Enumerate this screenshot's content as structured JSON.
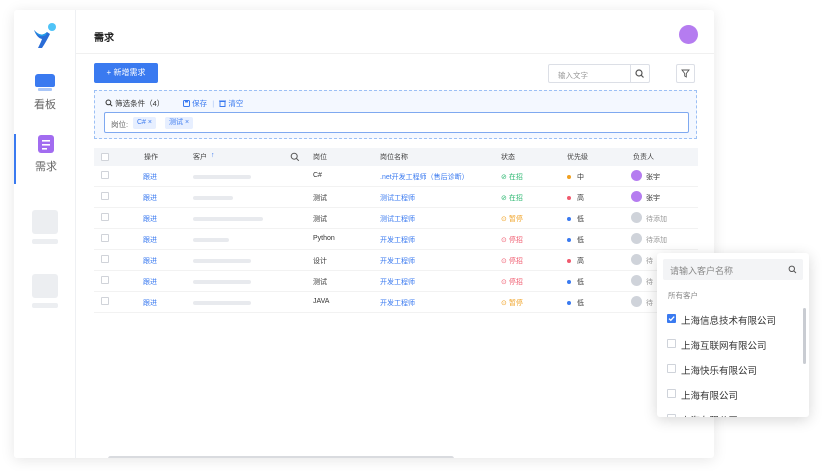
{
  "sidebar": {
    "nav": [
      {
        "label": "看板",
        "icon": "monitor-icon"
      },
      {
        "label": "需求",
        "icon": "document-icon"
      }
    ]
  },
  "header": {
    "title": "需求"
  },
  "toolbar": {
    "new_button": "+ 新增需求",
    "search_placeholder": "输入文字"
  },
  "filter": {
    "title": "筛选条件（4）",
    "save": "保存",
    "divider": "|",
    "clear": "清空",
    "field_label": "岗位:",
    "tags": [
      "C# ×",
      "测试 ×"
    ]
  },
  "table": {
    "headers": [
      "操作",
      "客户",
      "岗位",
      "岗位名称",
      "状态",
      "优先级",
      "负责人"
    ],
    "sort_marker": "↑",
    "rows": [
      {
        "action": "跟进",
        "job": "C#",
        "job_name": ".net开发工程师（售后诊断）",
        "status": "在招",
        "priority": "中",
        "owner": "张宇"
      },
      {
        "action": "跟进",
        "job": "测试",
        "job_name": "测试工程师",
        "status": "在招",
        "priority": "高",
        "owner": "张宇"
      },
      {
        "action": "跟进",
        "job": "测试",
        "job_name": "测试工程师",
        "status": "暂停",
        "priority": "低",
        "owner": "待添加"
      },
      {
        "action": "跟进",
        "job": "Python",
        "job_name": "开发工程师",
        "status": "停招",
        "priority": "低",
        "owner": "待添加"
      },
      {
        "action": "跟进",
        "job": "设计",
        "job_name": "开发工程师",
        "status": "停招",
        "priority": "高",
        "owner": "待"
      },
      {
        "action": "跟进",
        "job": "测试",
        "job_name": "开发工程师",
        "status": "停招",
        "priority": "低",
        "owner": "待"
      },
      {
        "action": "跟进",
        "job": "JAVA",
        "job_name": "开发工程师",
        "status": "暂停",
        "priority": "低",
        "owner": "待"
      }
    ]
  },
  "dropdown": {
    "search_placeholder": "请输入客户名称",
    "group_label": "所有客户",
    "options": [
      {
        "label": "上海信息技术有限公司",
        "checked": true
      },
      {
        "label": "上海互联网有限公司",
        "checked": false
      },
      {
        "label": "上海快乐有限公司",
        "checked": false
      },
      {
        "label": "上海有限公司",
        "checked": false
      },
      {
        "label": "上海有限公司",
        "checked": false
      }
    ]
  },
  "colors": {
    "accent": "#3a7af0",
    "status_active": "#2eb872",
    "status_paused": "#f0a020",
    "status_stopped": "#f05a6e",
    "priority_high": "#f05a6e",
    "priority_mid": "#f0a020",
    "priority_low": "#3a7af0"
  }
}
